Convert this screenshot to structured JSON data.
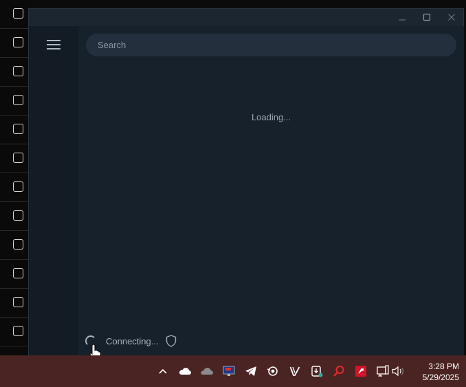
{
  "app": {
    "window_controls": {
      "minimize_icon": "minimize-icon",
      "maximize_icon": "maximize-icon",
      "close_icon": "close-icon"
    },
    "sidebar": {
      "menu_icon": "hamburger-menu-icon"
    },
    "search": {
      "placeholder": "Search",
      "value": ""
    },
    "main": {
      "loading_text": "Loading..."
    },
    "status": {
      "text": "Connecting...",
      "spinner_icon": "spinner-icon",
      "proxy_icon": "shield-icon"
    }
  },
  "taskbar": {
    "tray": [
      {
        "name": "chevron-up-icon"
      },
      {
        "name": "onedrive-icon"
      },
      {
        "name": "cloud-icon"
      },
      {
        "name": "monitor-app-icon"
      },
      {
        "name": "telegram-icon"
      },
      {
        "name": "steam-icon"
      },
      {
        "name": "v-app-icon"
      },
      {
        "name": "download-app-icon"
      },
      {
        "name": "search-app-icon"
      },
      {
        "name": "amd-icon"
      },
      {
        "name": "network-icon"
      },
      {
        "name": "volume-icon"
      }
    ],
    "clock": {
      "time": "3:28 PM",
      "date": "5/29/2025"
    }
  },
  "colors": {
    "window_bg": "#17212b",
    "sidebar_bg": "#131c25",
    "search_bg": "#242f3d",
    "taskbar_bg": "#4a2422"
  }
}
